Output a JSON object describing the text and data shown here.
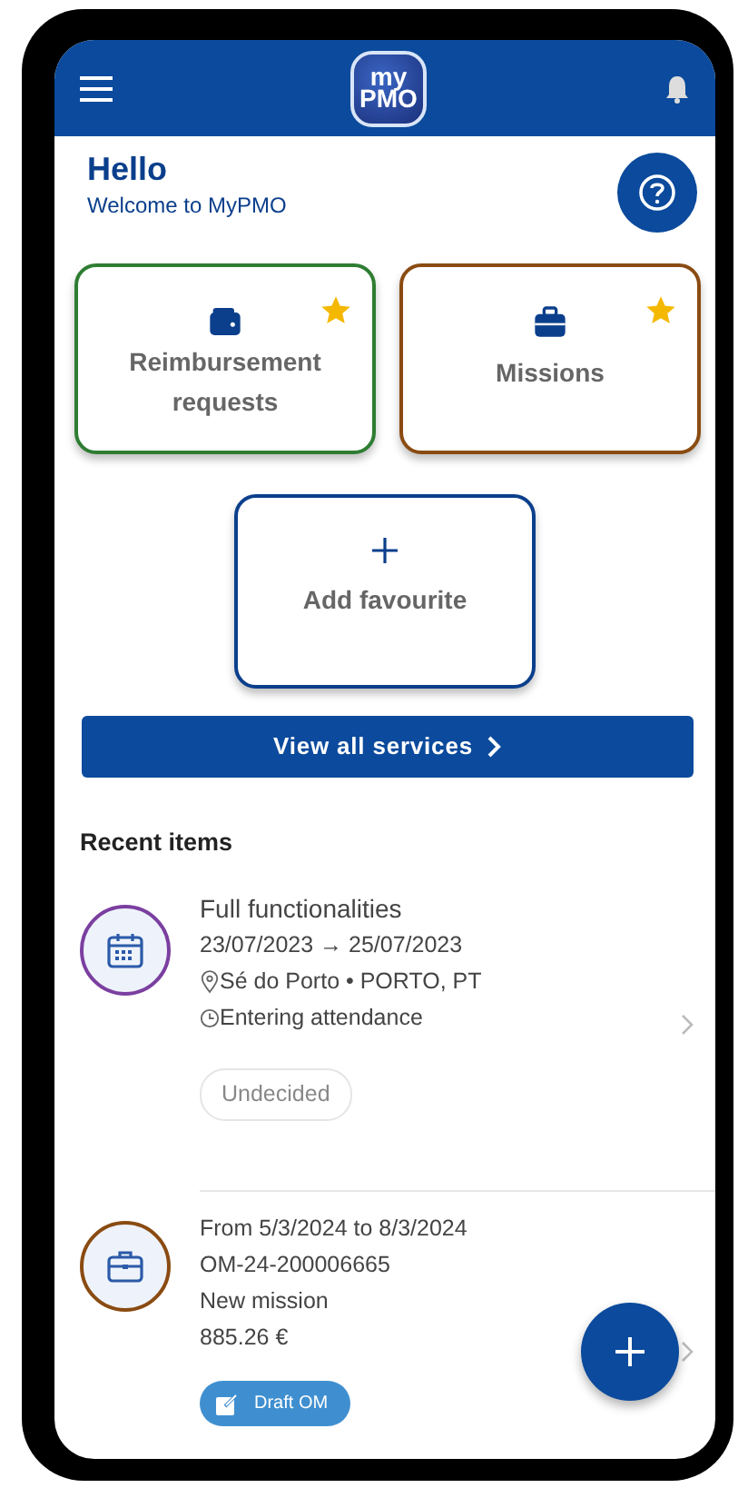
{
  "header": {
    "logo": {
      "top": "my",
      "bottom": "PMO"
    }
  },
  "greeting": {
    "title": "Hello",
    "subtitle": "Welcome to MyPMO"
  },
  "favourites": [
    {
      "label": "Reimbursement requests",
      "kind": "reimbursement",
      "color": "#2e7d32",
      "starred": true
    },
    {
      "label": "Missions",
      "kind": "mission",
      "color": "#8a4b12",
      "starred": true
    }
  ],
  "add_favourite": {
    "label": "Add favourite"
  },
  "view_all_button": {
    "label": "View all services"
  },
  "recent": {
    "title": "Recent items",
    "items": [
      {
        "kind": "event",
        "color": "#7b3fa0",
        "lines": [
          {
            "text": "Full functionalities",
            "kind": "title"
          },
          {
            "text": "23/07/2023 → 25/07/2023",
            "kind": "plain"
          },
          {
            "text": "Sé do Porto • PORTO, PT",
            "kind": "location"
          },
          {
            "text": "Entering attendance",
            "kind": "status"
          }
        ],
        "tag": {
          "label": "Undecided",
          "filled": false
        }
      },
      {
        "kind": "mission",
        "color": "#8a4b12",
        "lines": [
          {
            "text": "From 5/3/2024 to 8/3/2024",
            "kind": "plain"
          },
          {
            "text": "OM-24-200006665",
            "kind": "plain"
          },
          {
            "text": "New mission",
            "kind": "plain"
          },
          {
            "text": "885.26 €",
            "kind": "plain"
          }
        ],
        "tag": {
          "label": "Draft OM",
          "filled": true
        }
      }
    ]
  }
}
